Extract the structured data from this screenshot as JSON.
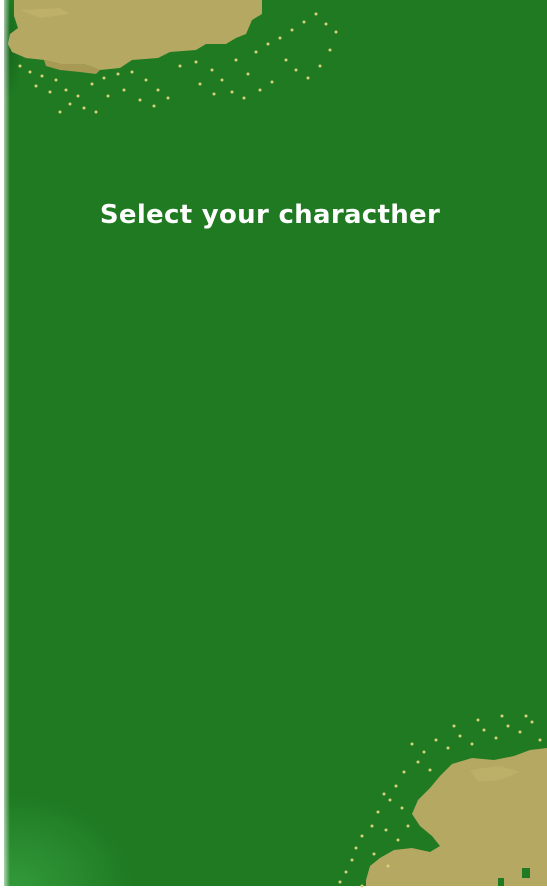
{
  "screen": {
    "title": "Select your characther"
  },
  "colors": {
    "grass": "#1f7a22",
    "sand": "#b5a862",
    "sand_dark": "#c7bb72",
    "foliage_dots": "#d8d27a",
    "title_text": "#ffffff"
  },
  "decorations": {
    "top_left": "sand-patch",
    "bottom_right": "sand-patch"
  }
}
